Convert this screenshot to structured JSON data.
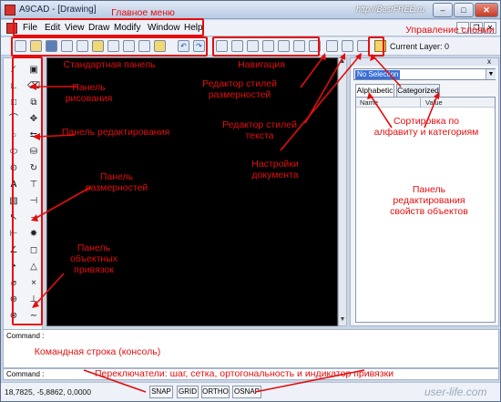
{
  "window": {
    "title": "A9CAD - [Drawing]",
    "watermark_top": "http://BestFREE.ru",
    "controls": {
      "minimize": "–",
      "maximize": "□",
      "close": "✕"
    }
  },
  "menu": {
    "items": [
      "File",
      "Edit",
      "View",
      "Draw",
      "Modify",
      "Window",
      "Help"
    ],
    "mdi_controls": [
      "–",
      "❐",
      "✕"
    ]
  },
  "toolbar": {
    "current_layer": "Current Layer: 0"
  },
  "properties_panel": {
    "selection": "No Selection",
    "tabs": [
      "Alphabetic",
      "Categorized"
    ],
    "columns": [
      "Name",
      "Value"
    ],
    "close_glyph": "x"
  },
  "command": {
    "label_top": "Command :",
    "label_input": "Command :"
  },
  "status": {
    "coords": "18,7825, -5,8862, 0,0000",
    "toggles": [
      "SNAP",
      "GRID",
      "ORTHO",
      "OSNAP"
    ],
    "watermark_bottom": "user-life.com"
  },
  "annotations": {
    "main_menu": "Главное меню",
    "layers": "Управление слоями",
    "std_panel": "Стандартная панель",
    "navigation": "Навигация",
    "draw_panel": "Панель рисования",
    "dim_style_editor": "Редактор стилей размерностей",
    "edit_panel": "Панель редактирования",
    "text_style_editor": "Редактор стилей текста",
    "sort": "Сортировка по алфавиту и категориям",
    "doc_settings": "Настройки документа",
    "dim_panel": "Панель размерностей",
    "props_panel": "Панель редактирования свойств объектов",
    "snap_panel": "Панель объектных привязок",
    "command_line": "Командная строка (консоль)",
    "toggles": "Переключатели: шаг, сетка, ортогональность и индикатор привязки"
  },
  "colors": {
    "annotation": "#e30e0e",
    "canvas": "#000000",
    "selection_highlight": "#3a6fd6"
  }
}
